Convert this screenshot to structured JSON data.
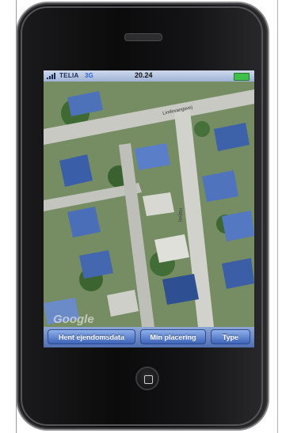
{
  "status_bar": {
    "carrier": "TELIA",
    "network": "3G",
    "time": "20.24"
  },
  "map": {
    "watermark": "Google",
    "street_labels": [
      "Lindevangsvej",
      "Højvej"
    ]
  },
  "toolbar": {
    "buttons": [
      {
        "label": "Hent ejendomsdata"
      },
      {
        "label": "Min placering"
      },
      {
        "label": "Type"
      }
    ]
  },
  "colors": {
    "toolbar": "#4f6fb3",
    "button": "#3d63b8",
    "battery": "#3fc04b",
    "phone_body": "#0b0b0c"
  }
}
